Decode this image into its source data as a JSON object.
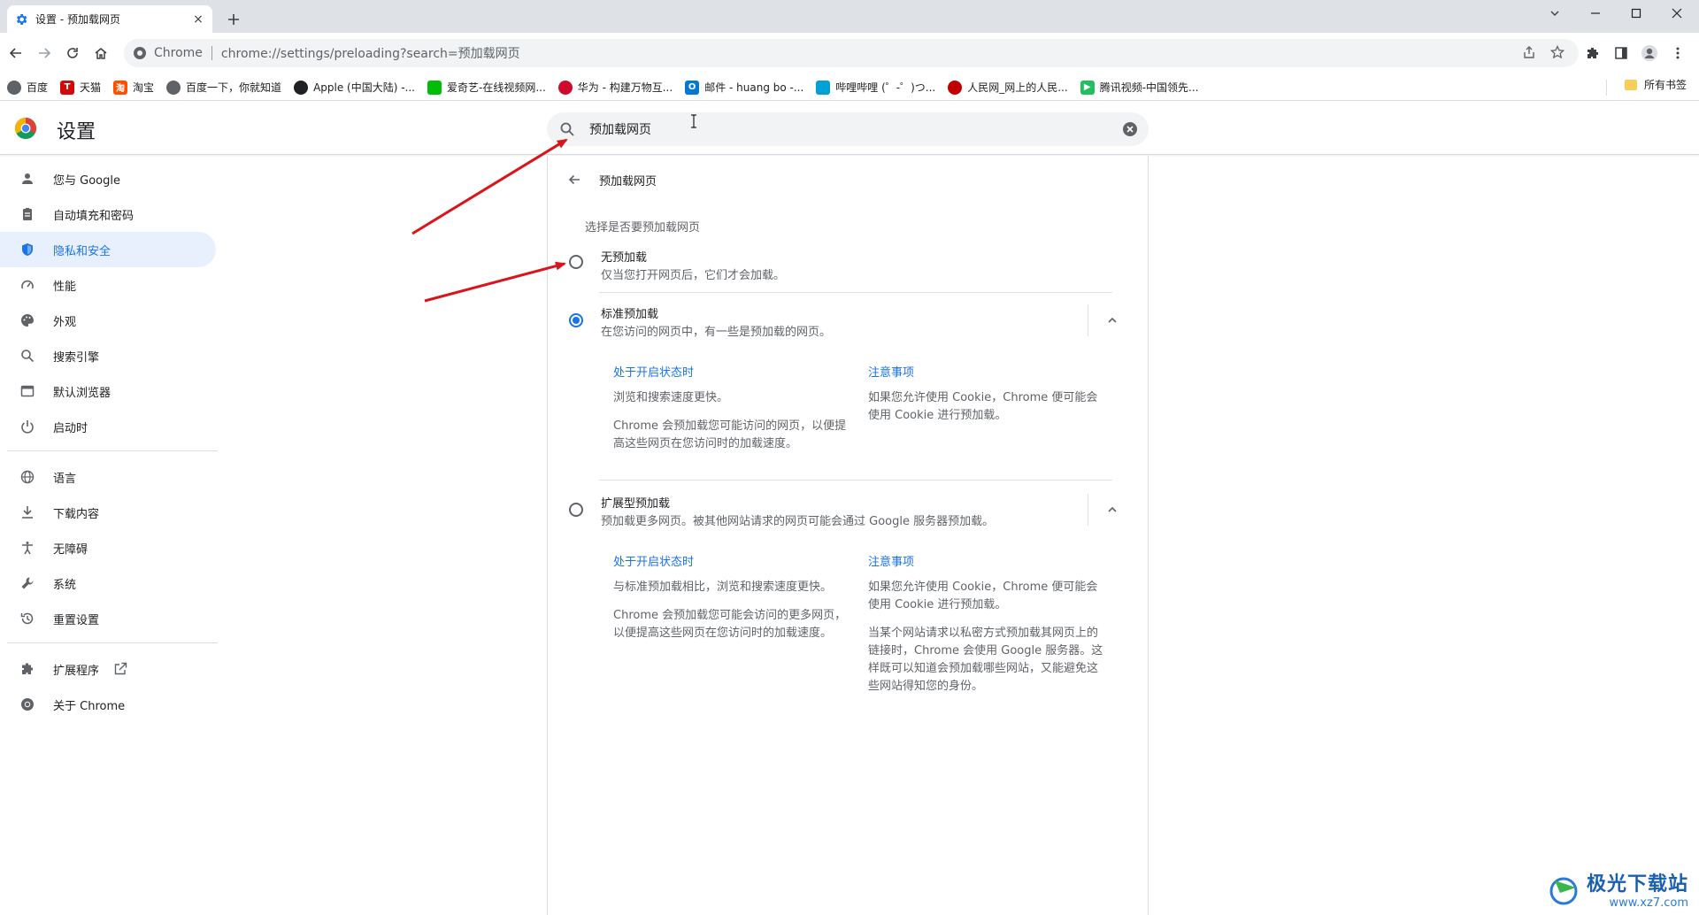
{
  "tab": {
    "title": "设置 - 预加载网页",
    "close": "×",
    "new_tab": "+"
  },
  "address_bar": {
    "site_name": "Chrome",
    "url": "chrome://settings/preloading?search=预加载网页"
  },
  "bookmarks": {
    "items": [
      {
        "label": "百度",
        "color": "#5f6368"
      },
      {
        "label": "天猫",
        "color": "#d30a0a"
      },
      {
        "label": "淘宝",
        "color": "#ff5000"
      },
      {
        "label": "百度一下，你就知道",
        "color": "#5f6368"
      },
      {
        "label": "Apple (中国大陆) -...",
        "color": "#202124"
      },
      {
        "label": "爱奇艺-在线视频网...",
        "color": "#00be06"
      },
      {
        "label": "华为 - 构建万物互...",
        "color": "#cf0a2c"
      },
      {
        "label": "邮件 - huang bo -...",
        "color": "#0078d4"
      },
      {
        "label": "哔哩哔哩 (゜-゜)つ...",
        "color": "#00a1d6"
      },
      {
        "label": "人民网_网上的人民...",
        "color": "#c00000"
      },
      {
        "label": "腾讯视频-中国领先...",
        "color": "#20c060"
      }
    ],
    "all_bookmarks": "所有书签"
  },
  "header": {
    "title": "设置",
    "search_value": "预加载网页"
  },
  "sidebar": {
    "items": [
      {
        "label": "您与 Google",
        "icon": "person-icon"
      },
      {
        "label": "自动填充和密码",
        "icon": "clipboard-icon"
      },
      {
        "label": "隐私和安全",
        "icon": "shield-icon"
      },
      {
        "label": "性能",
        "icon": "speedometer-icon"
      },
      {
        "label": "外观",
        "icon": "palette-icon"
      },
      {
        "label": "搜索引擎",
        "icon": "search-icon"
      },
      {
        "label": "默认浏览器",
        "icon": "browser-icon"
      },
      {
        "label": "启动时",
        "icon": "power-icon"
      },
      {
        "label": "语言",
        "icon": "globe-icon"
      },
      {
        "label": "下载内容",
        "icon": "download-icon"
      },
      {
        "label": "无障碍",
        "icon": "accessibility-icon"
      },
      {
        "label": "系统",
        "icon": "wrench-icon"
      },
      {
        "label": "重置设置",
        "icon": "history-icon"
      },
      {
        "label": "扩展程序",
        "icon": "puzzle-icon"
      },
      {
        "label": "关于 Chrome",
        "icon": "chrome-icon"
      }
    ],
    "active_index": 2
  },
  "main": {
    "page_heading": "预加载网页",
    "section_label": "选择是否要预加载网页",
    "options": [
      {
        "title": "无预加载",
        "desc": "仅当您打开网页后，它们才会加载。",
        "checked": false
      },
      {
        "title": "标准预加载",
        "desc": "在您访问的网页中，有一些是预加载的网页。",
        "checked": true,
        "left_head": "处于开启状态时",
        "left_p1": "浏览和搜索速度更快。",
        "left_p2": "Chrome 会预加载您可能访问的网页，以便提高这些网页在您访问时的加载速度。",
        "right_head": "注意事项",
        "right_p1": "如果您允许使用 Cookie，Chrome 便可能会使用 Cookie 进行预加载。"
      },
      {
        "title": "扩展型预加载",
        "desc": "预加载更多网页。被其他网站请求的网页可能会通过 Google 服务器预加载。",
        "checked": false,
        "left_head": "处于开启状态时",
        "left_p1": "与标准预加载相比，浏览和搜索速度更快。",
        "left_p2": "Chrome 会预加载您可能会访问的更多网页，以便提高这些网页在您访问时的加载速度。",
        "right_head": "注意事项",
        "right_p1": "如果您允许使用 Cookie，Chrome 便可能会使用 Cookie 进行预加载。",
        "right_p2": "当某个网站请求以私密方式预加载其网页上的链接时，Chrome 会使用 Google 服务器。这样既可以知道会预加载哪些网站，又能避免这些网站得知您的身份。"
      }
    ]
  },
  "colors": {
    "accent": "#1a73e8",
    "arrow": "#d9151b"
  },
  "watermark": {
    "cn": "极光下载站",
    "url": "www.xz7.com"
  }
}
